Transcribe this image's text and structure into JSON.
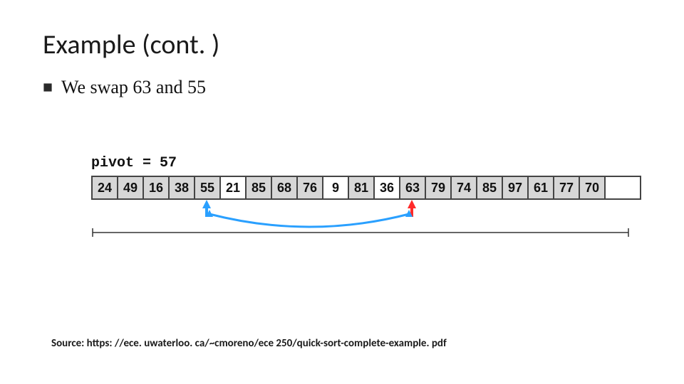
{
  "title": "Example (cont. )",
  "statement": "We swap 63 and 55",
  "pivot_label": "pivot = 57",
  "source": "Source: https: //ece. uwaterloo. ca/~cmoreno/ece 250/quick-sort-complete-example. pdf",
  "array": {
    "cells": [
      {
        "v": "24",
        "shade": "gray"
      },
      {
        "v": "49",
        "shade": "gray"
      },
      {
        "v": "16",
        "shade": "gray"
      },
      {
        "v": "38",
        "shade": "gray"
      },
      {
        "v": "55",
        "shade": "gray"
      },
      {
        "v": "21",
        "shade": "white"
      },
      {
        "v": "85",
        "shade": "gray"
      },
      {
        "v": "68",
        "shade": "gray"
      },
      {
        "v": "76",
        "shade": "gray"
      },
      {
        "v": "9",
        "shade": "white"
      },
      {
        "v": "81",
        "shade": "gray"
      },
      {
        "v": "36",
        "shade": "white"
      },
      {
        "v": "63",
        "shade": "gray"
      },
      {
        "v": "79",
        "shade": "gray"
      },
      {
        "v": "74",
        "shade": "gray"
      },
      {
        "v": "85",
        "shade": "gray"
      },
      {
        "v": "97",
        "shade": "gray"
      },
      {
        "v": "61",
        "shade": "gray"
      },
      {
        "v": "77",
        "shade": "gray"
      },
      {
        "v": "70",
        "shade": "gray"
      },
      {
        "v": "",
        "shade": "white"
      }
    ],
    "blue_pointer_index": 4,
    "red_pointer_index": 12,
    "swap_arc": {
      "from_index": 4,
      "to_index": 12
    }
  },
  "colors": {
    "blue": "#2aa0ff",
    "red": "#ff2a2a",
    "dark": "#333333"
  }
}
